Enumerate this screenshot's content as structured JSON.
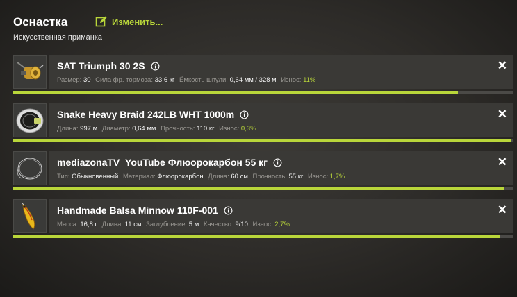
{
  "header": {
    "title": "Оснастка",
    "edit_label": "Изменить...",
    "subtitle": "Искусственная приманка"
  },
  "colors": {
    "accent": "#b9d63a",
    "panel": "#3a3936",
    "muted": "#9a9893"
  },
  "items": [
    {
      "name": "SAT Triumph 30 2S",
      "icon": "reel-icon",
      "stats": [
        {
          "k": "Размер:",
          "v": "30"
        },
        {
          "k": "Сила фр. тормоза:",
          "v": "33,6 кг"
        },
        {
          "k": "Ёмкость шпули:",
          "v": "0,64 мм / 328 м"
        },
        {
          "k": "Износ:",
          "v": "11%",
          "wear": true
        }
      ],
      "condition": 0.89
    },
    {
      "name": "Snake Heavy Braid 242LB WHT 1000m",
      "icon": "line-spool-icon",
      "stats": [
        {
          "k": "Длина:",
          "v": "997 м"
        },
        {
          "k": "Диаметр:",
          "v": "0,64 мм"
        },
        {
          "k": "Прочность:",
          "v": "110 кг"
        },
        {
          "k": "Износ:",
          "v": "0,3%",
          "wear": true
        }
      ],
      "condition": 0.997
    },
    {
      "name": "mediazonaTV_YouTube Флюорокарбон 55 кг",
      "icon": "leader-icon",
      "stats": [
        {
          "k": "Тип:",
          "v": "Обыкновенный"
        },
        {
          "k": "Материал:",
          "v": "Флюорокарбон"
        },
        {
          "k": "Длина:",
          "v": "60 см"
        },
        {
          "k": "Прочность:",
          "v": "55 кг"
        },
        {
          "k": "Износ:",
          "v": "1,7%",
          "wear": true
        }
      ],
      "condition": 0.983
    },
    {
      "name": "Handmade Balsa Minnow 110F-001",
      "icon": "minnow-lure-icon",
      "stats": [
        {
          "k": "Масса:",
          "v": "16,8 г"
        },
        {
          "k": "Длина:",
          "v": "11 см"
        },
        {
          "k": "Заглубление:",
          "v": "5 м"
        },
        {
          "k": "Качество:",
          "v": "9/10"
        },
        {
          "k": "Износ:",
          "v": "2,7%",
          "wear": true
        }
      ],
      "condition": 0.973
    }
  ]
}
